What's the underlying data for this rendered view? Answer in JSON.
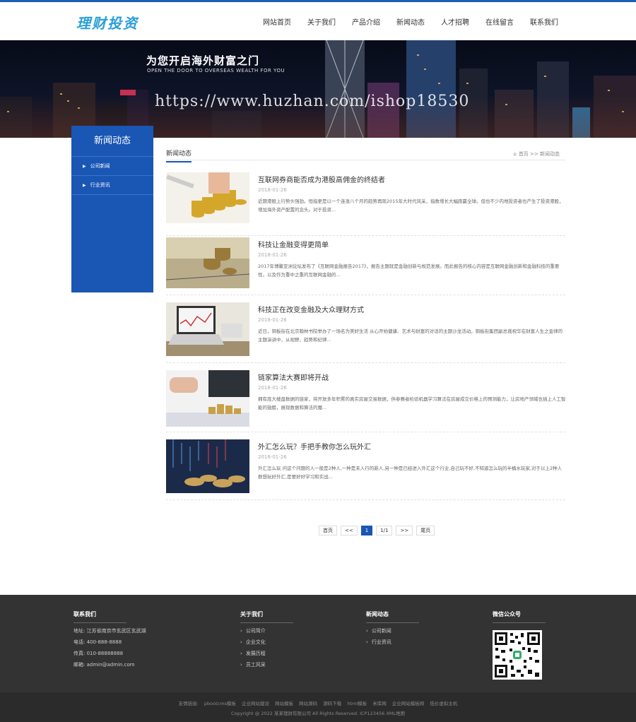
{
  "header": {
    "logo": "理财投资",
    "nav": [
      "网站首页",
      "关于我们",
      "产品介绍",
      "新闻动态",
      "人才招聘",
      "在线留言",
      "联系我们"
    ]
  },
  "banner": {
    "headline": "为您开启海外财富之门",
    "subline": "OPEN THE DOOR TO OVERSEAS WEALTH FOR YOU",
    "watermark": "https://www.huzhan.com/ishop18530"
  },
  "sidebar": {
    "title": "新闻动态",
    "items": [
      {
        "label": "公司新闻"
      },
      {
        "label": "行业资讯"
      }
    ]
  },
  "main": {
    "title": "新闻动态",
    "breadcrumb": "首页 >> 新闻动态"
  },
  "news": [
    {
      "title": "互联网券商能否成为港股高佣金的终结者",
      "date": "2018-01-26",
      "desc": "近期港股上行势头强劲。恒指更是以一个连涨八个月的趋势再现2015年大时代风采，指数增长大幅跑赢全球。但也不少内地投资者也产生了投资港股，增加海外资产配置的念头。对于投资..."
    },
    {
      "title": "科技让金融变得更简单",
      "date": "2018-01-26",
      "desc": "2017年博鳌亚洲论坛发布了《互联网金融报告2017》，报告主题就是金融创新与规范发展。而此报告的核心内容是互联网金融创新和金融科技的重要性，以及作为重中之重的互联网金融的..."
    },
    {
      "title": "科技正在改变金融及大众理财方式",
      "date": "2018-01-26",
      "desc": "近日，铜板街在北京翰林书院举办了一场名为美好生活 从心开始健康、艺术与财富的对话的主题沙龙活动。铜板街集团副总裁祝华在财富人生之金律的主题演讲中，从视野、趋势和纪律..."
    },
    {
      "title": "链家算法大赛即将开战",
      "date": "2018-01-26",
      "desc": "拥有庞大楼盘数据的链家，将开放多年积累的真实房屋交易数据，供参赛者检验机器学习算法在房屋成交价格上的预测能力，让房地产领域也插上人工智能的翅膀，展现数据和算法的魔..."
    },
    {
      "title": "外汇怎么玩？手把手教你怎么玩外汇",
      "date": "2018-01-26",
      "desc": "外汇怎么玩 问这个问题的人一般是2种人,一种是未入行的新人,另一种是已经进入外汇这个行业,自己玩不好,不知道怎么玩的半桶水玩家,对于以上2种人群想玩好外汇,是要好好学习和实战..."
    }
  ],
  "pager": [
    "首页",
    "<<",
    "1",
    "1/1",
    ">>",
    "尾页"
  ],
  "footer": {
    "contact": {
      "title": "联系我们",
      "lines": [
        "地址: 江苏省南京市玄武区玄武湖",
        "电话: 400-888-8888",
        "传真: 010-88888888",
        "邮箱: admin@admin.com"
      ]
    },
    "about": {
      "title": "关于我们",
      "links": [
        "公司简介",
        "企业文化",
        "发展历程",
        "员工风采"
      ]
    },
    "newscol": {
      "title": "新闻动态",
      "links": [
        "公司新闻",
        "行业资讯"
      ]
    },
    "wechat": {
      "title": "微信公众号"
    },
    "friend_links": [
      "友情链接:",
      "pbootcms模板",
      "企业网站建设",
      "网站模板",
      "网站源码",
      "源码下载",
      "html模板",
      "米库网",
      "企业网站模板网",
      "低价虚拟主机"
    ],
    "copyright": "Copyright @ 2022 某某理财有限公司 All Rights Reserved. ICP123456 XML地图"
  }
}
